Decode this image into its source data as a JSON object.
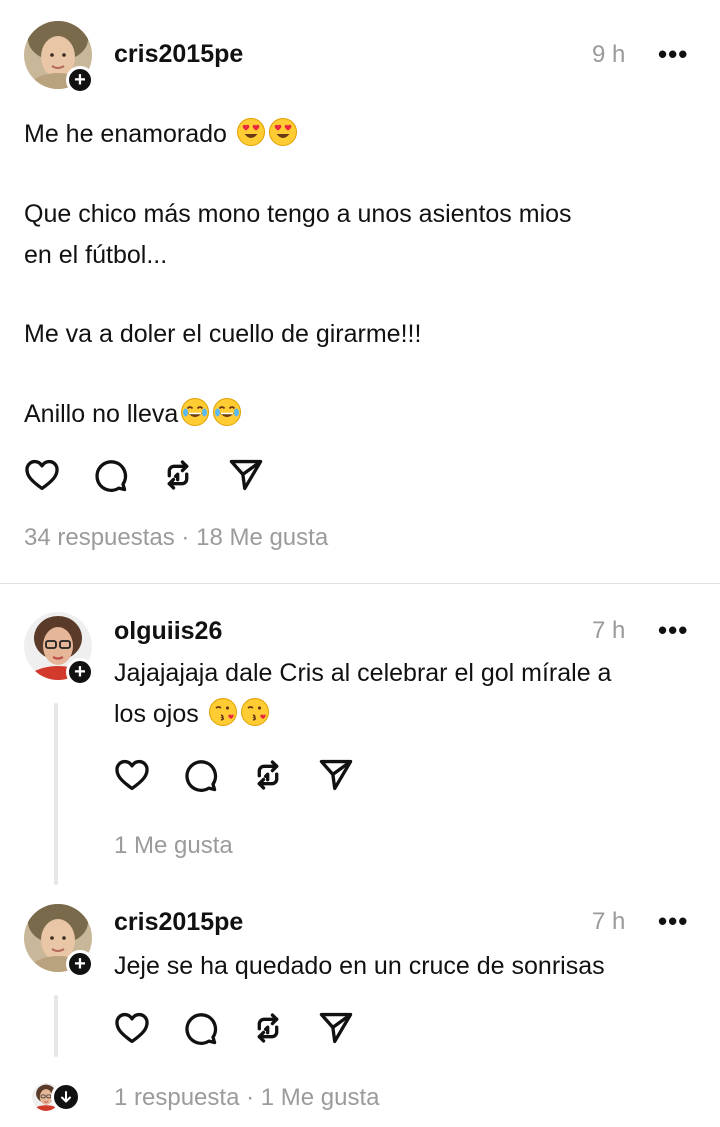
{
  "post": {
    "username": "cris2015pe",
    "time": "9 h",
    "more": "•••",
    "lines": [
      "Me he enamorado",
      "Que chico más mono tengo a unos asientos mios",
      "en el fútbol...",
      "Me va a doler el cuello de girarme!!!",
      "Anillo no lleva"
    ],
    "line1_emoji": "heart-eyes",
    "line5_emoji": "tears-of-joy",
    "stats": "34 respuestas · 18 Me gusta"
  },
  "reply1": {
    "username": "olguiis26",
    "time": "7 h",
    "more": "•••",
    "line1": "Jajajajaja dale Cris al celebrar el gol mírale a",
    "line2": "los ojos",
    "emoji": "kissing-heart",
    "stats": "1 Me gusta"
  },
  "reply2": {
    "username": "cris2015pe",
    "time": "7 h",
    "more": "•••",
    "text": "Jeje se ha quedado en un cruce de sonrisas",
    "stats": "1 respuesta · 1 Me gusta"
  },
  "icons": {
    "like": "heart-icon",
    "comment": "comment-icon",
    "repost": "repost-icon",
    "share": "send-icon"
  }
}
